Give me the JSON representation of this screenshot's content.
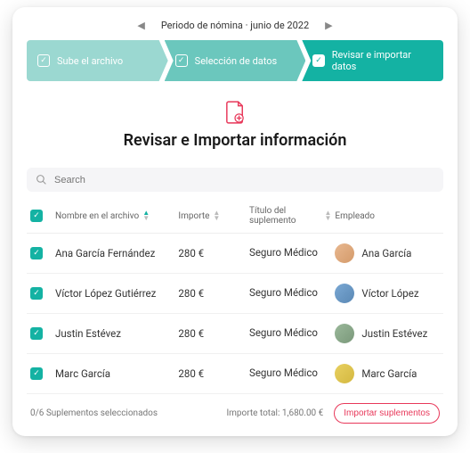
{
  "period": {
    "label": "Periodo de nómina · junio de 2022"
  },
  "stepper": {
    "step1": "Sube el archivo",
    "step2": "Selección de datos",
    "step3": "Revisar e importar datos"
  },
  "main_title": "Revisar e Importar información",
  "search": {
    "placeholder": "Search"
  },
  "table": {
    "headers": {
      "name": "Nombre en el archivo",
      "amount": "Importe",
      "supplement": "Título del suplemento",
      "employee": "Empleado"
    },
    "rows": [
      {
        "name": "Ana García Fernández",
        "amount": "280 €",
        "supplement": "Seguro Médico",
        "employee": "Ana García"
      },
      {
        "name": "Víctor López Gutiérrez",
        "amount": "280 €",
        "supplement": "Seguro Médico",
        "employee": "Víctor López"
      },
      {
        "name": "Justin Estévez",
        "amount": "280 €",
        "supplement": "Seguro Médico",
        "employee": "Justin Estévez"
      },
      {
        "name": "Marc García",
        "amount": "280 €",
        "supplement": "Seguro Médico",
        "employee": "Marc García"
      }
    ]
  },
  "footer": {
    "selected": "0/6 Suplementos seleccionados",
    "total": "Importe total: 1,680.00 €",
    "import_btn": "Importar suplementos"
  }
}
